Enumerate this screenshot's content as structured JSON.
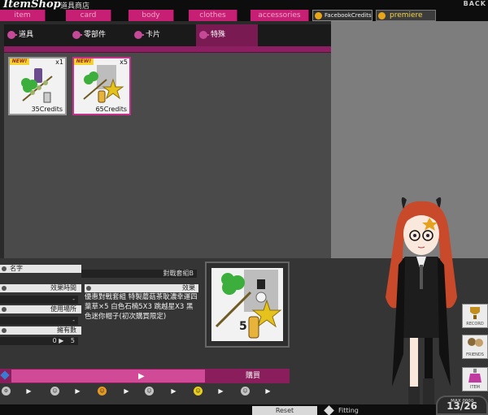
{
  "header": {
    "shop_title": "ItemShop",
    "shop_subtitle": "道具商店",
    "corner_text": "BACK"
  },
  "category_tabs": [
    {
      "label": "item"
    },
    {
      "label": "card"
    },
    {
      "label": "body"
    },
    {
      "label": "clothes"
    },
    {
      "label": "accessories"
    }
  ],
  "facebook_tab": {
    "label": "FacebookCredits"
  },
  "premiere_tab": {
    "label": "premiere"
  },
  "sub_tabs": [
    {
      "label": "道具"
    },
    {
      "label": "零部件"
    },
    {
      "label": "卡片"
    },
    {
      "label": "特殊"
    }
  ],
  "items": [
    {
      "badge": "NEW!",
      "qty": "x1",
      "price": "35Credits"
    },
    {
      "badge": "NEW!",
      "qty": "x5",
      "price": "65Credits"
    }
  ],
  "detail": {
    "name_label": "名字",
    "name_value": "對戰套組B",
    "duration_label": "效果時間",
    "duration_value": "-",
    "location_label": "使用場所",
    "location_value": "-",
    "owned_label": "擁有數",
    "owned_value": "0",
    "owned_after": "5",
    "effect_label": "效果",
    "description": "優惠對戰套組 特製蘑菇茶耿濃幸運四葉草×5 白色石楠5X3 跳越星X3 黑色迷你帽子(初次購買限定)"
  },
  "preview": {
    "count": "5"
  },
  "buy": {
    "label": "購買"
  },
  "bottom": {
    "reset_label": "Reset",
    "fitting_label": "Fitting",
    "counter": "13/26",
    "counter_caption": "MAX 0000"
  },
  "side_buttons": [
    {
      "label": "RECORD"
    },
    {
      "label": "FRIENDS"
    },
    {
      "label": "ITEM"
    }
  ],
  "colors": {
    "accent": "#c71f74",
    "panel": "#4a4a4a",
    "highlight": "#7a1a52"
  }
}
